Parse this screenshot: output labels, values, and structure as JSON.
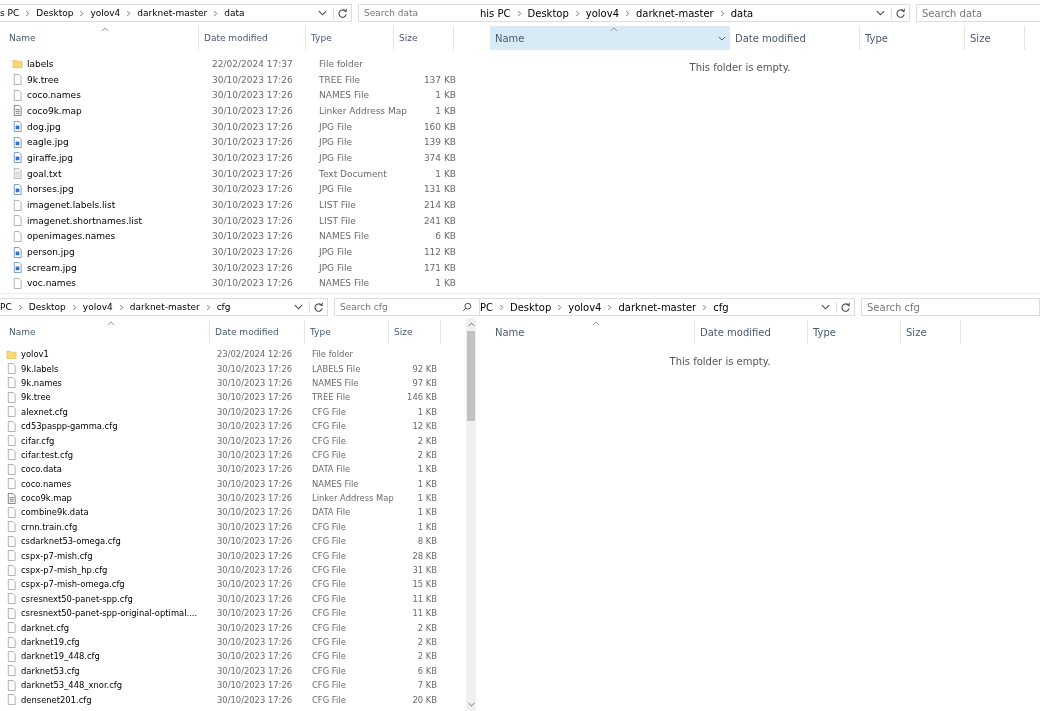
{
  "panes": [
    {
      "path": [
        "s PC",
        "Desktop",
        "yolov4",
        "darknet-master",
        "data"
      ],
      "search": {
        "placeholder": "Search data"
      },
      "scrollbar": false,
      "columns": [
        {
          "label": "Name",
          "selected": false
        },
        {
          "label": "Date modified",
          "selected": false
        },
        {
          "label": "Type",
          "selected": false
        },
        {
          "label": "Size",
          "selected": false
        }
      ],
      "rows": [
        {
          "kind": "folder",
          "name": "labels",
          "date": "22/02/2024 17:37",
          "type": "File folder",
          "size": ""
        },
        {
          "kind": "file",
          "name": "9k.tree",
          "date": "30/10/2023 17:26",
          "type": "TREE File",
          "size": "137 KB"
        },
        {
          "kind": "file",
          "name": "coco.names",
          "date": "30/10/2023 17:26",
          "type": "NAMES File",
          "size": "1 KB"
        },
        {
          "kind": "map",
          "name": "coco9k.map",
          "date": "30/10/2023 17:26",
          "type": "Linker Address Map",
          "size": "1 KB"
        },
        {
          "kind": "image",
          "name": "dog.jpg",
          "date": "30/10/2023 17:26",
          "type": "JPG File",
          "size": "160 KB"
        },
        {
          "kind": "image",
          "name": "eagle.jpg",
          "date": "30/10/2023 17:26",
          "type": "JPG File",
          "size": "139 KB"
        },
        {
          "kind": "image",
          "name": "giraffe.jpg",
          "date": "30/10/2023 17:26",
          "type": "JPG File",
          "size": "374 KB"
        },
        {
          "kind": "text",
          "name": "goal.txt",
          "date": "30/10/2023 17:26",
          "type": "Text Document",
          "size": "1 KB"
        },
        {
          "kind": "image",
          "name": "horses.jpg",
          "date": "30/10/2023 17:26",
          "type": "JPG File",
          "size": "131 KB"
        },
        {
          "kind": "file",
          "name": "imagenet.labels.list",
          "date": "30/10/2023 17:26",
          "type": "LIST File",
          "size": "214 KB"
        },
        {
          "kind": "file",
          "name": "imagenet.shortnames.list",
          "date": "30/10/2023 17:26",
          "type": "LIST File",
          "size": "241 KB"
        },
        {
          "kind": "file",
          "name": "openimages.names",
          "date": "30/10/2023 17:26",
          "type": "NAMES File",
          "size": "6 KB"
        },
        {
          "kind": "image",
          "name": "person.jpg",
          "date": "30/10/2023 17:26",
          "type": "JPG File",
          "size": "112 KB"
        },
        {
          "kind": "image",
          "name": "scream.jpg",
          "date": "30/10/2023 17:26",
          "type": "JPG File",
          "size": "171 KB"
        },
        {
          "kind": "file",
          "name": "voc.names",
          "date": "30/10/2023 17:26",
          "type": "NAMES File",
          "size": "1 KB"
        }
      ]
    },
    {
      "path": [
        "his PC",
        "Desktop",
        "yolov4",
        "darknet-master",
        "data"
      ],
      "search": {
        "placeholder": "Search data"
      },
      "scrollbar": false,
      "columns": [
        {
          "label": "Name",
          "selected": true
        },
        {
          "label": "Date modified",
          "selected": false
        },
        {
          "label": "Type",
          "selected": false
        },
        {
          "label": "Size",
          "selected": false
        }
      ],
      "empty_message": "This folder is empty."
    },
    {
      "path": [
        "PC",
        "Desktop",
        "yolov4",
        "darknet-master",
        "cfg"
      ],
      "search": {
        "placeholder": "Search cfg"
      },
      "scrollbar": true,
      "columns": [
        {
          "label": "Name",
          "selected": false
        },
        {
          "label": "Date modified",
          "selected": false
        },
        {
          "label": "Type",
          "selected": false
        },
        {
          "label": "Size",
          "selected": false
        }
      ],
      "rows": [
        {
          "kind": "folder",
          "name": "yolov1",
          "date": "23/02/2024 12:26",
          "type": "File folder",
          "size": ""
        },
        {
          "kind": "file",
          "name": "9k.labels",
          "date": "30/10/2023 17:26",
          "type": "LABELS File",
          "size": "92 KB"
        },
        {
          "kind": "file",
          "name": "9k.names",
          "date": "30/10/2023 17:26",
          "type": "NAMES File",
          "size": "97 KB"
        },
        {
          "kind": "file",
          "name": "9k.tree",
          "date": "30/10/2023 17:26",
          "type": "TREE File",
          "size": "146 KB"
        },
        {
          "kind": "file",
          "name": "alexnet.cfg",
          "date": "30/10/2023 17:26",
          "type": "CFG File",
          "size": "1 KB"
        },
        {
          "kind": "file",
          "name": "cd53paspp-gamma.cfg",
          "date": "30/10/2023 17:26",
          "type": "CFG File",
          "size": "12 KB"
        },
        {
          "kind": "file",
          "name": "cifar.cfg",
          "date": "30/10/2023 17:26",
          "type": "CFG File",
          "size": "2 KB"
        },
        {
          "kind": "file",
          "name": "cifar.test.cfg",
          "date": "30/10/2023 17:26",
          "type": "CFG File",
          "size": "2 KB"
        },
        {
          "kind": "file",
          "name": "coco.data",
          "date": "30/10/2023 17:26",
          "type": "DATA File",
          "size": "1 KB"
        },
        {
          "kind": "file",
          "name": "coco.names",
          "date": "30/10/2023 17:26",
          "type": "NAMES File",
          "size": "1 KB"
        },
        {
          "kind": "map",
          "name": "coco9k.map",
          "date": "30/10/2023 17:26",
          "type": "Linker Address Map",
          "size": "1 KB"
        },
        {
          "kind": "file",
          "name": "combine9k.data",
          "date": "30/10/2023 17:26",
          "type": "DATA File",
          "size": "1 KB"
        },
        {
          "kind": "file",
          "name": "crnn.train.cfg",
          "date": "30/10/2023 17:26",
          "type": "CFG File",
          "size": "1 KB"
        },
        {
          "kind": "file",
          "name": "csdarknet53-omega.cfg",
          "date": "30/10/2023 17:26",
          "type": "CFG File",
          "size": "8 KB"
        },
        {
          "kind": "file",
          "name": "cspx-p7-mish.cfg",
          "date": "30/10/2023 17:26",
          "type": "CFG File",
          "size": "28 KB"
        },
        {
          "kind": "file",
          "name": "cspx-p7-mish_hp.cfg",
          "date": "30/10/2023 17:26",
          "type": "CFG File",
          "size": "31 KB"
        },
        {
          "kind": "file",
          "name": "cspx-p7-mish-omega.cfg",
          "date": "30/10/2023 17:26",
          "type": "CFG File",
          "size": "15 KB"
        },
        {
          "kind": "file",
          "name": "csresnext50-panet-spp.cfg",
          "date": "30/10/2023 17:26",
          "type": "CFG File",
          "size": "11 KB"
        },
        {
          "kind": "file",
          "name": "csresnext50-panet-spp-original-optimal....",
          "date": "30/10/2023 17:26",
          "type": "CFG File",
          "size": "11 KB"
        },
        {
          "kind": "file",
          "name": "darknet.cfg",
          "date": "30/10/2023 17:26",
          "type": "CFG File",
          "size": "2 KB"
        },
        {
          "kind": "file",
          "name": "darknet19.cfg",
          "date": "30/10/2023 17:26",
          "type": "CFG File",
          "size": "2 KB"
        },
        {
          "kind": "file",
          "name": "darknet19_448.cfg",
          "date": "30/10/2023 17:26",
          "type": "CFG File",
          "size": "2 KB"
        },
        {
          "kind": "file",
          "name": "darknet53.cfg",
          "date": "30/10/2023 17:26",
          "type": "CFG File",
          "size": "6 KB"
        },
        {
          "kind": "file",
          "name": "darknet53_448_xnor.cfg",
          "date": "30/10/2023 17:26",
          "type": "CFG File",
          "size": "7 KB"
        },
        {
          "kind": "file",
          "name": "densenet201.cfg",
          "date": "30/10/2023 17:26",
          "type": "CFG File",
          "size": "20 KB"
        }
      ]
    },
    {
      "path": [
        "PC",
        "Desktop",
        "yolov4",
        "darknet-master",
        "cfg"
      ],
      "search": {
        "placeholder": "Search cfg"
      },
      "scrollbar": false,
      "columns": [
        {
          "label": "Name",
          "selected": false
        },
        {
          "label": "Date modified",
          "selected": false
        },
        {
          "label": "Type",
          "selected": false
        },
        {
          "label": "Size",
          "selected": false
        }
      ],
      "empty_message": "This folder is empty."
    }
  ]
}
